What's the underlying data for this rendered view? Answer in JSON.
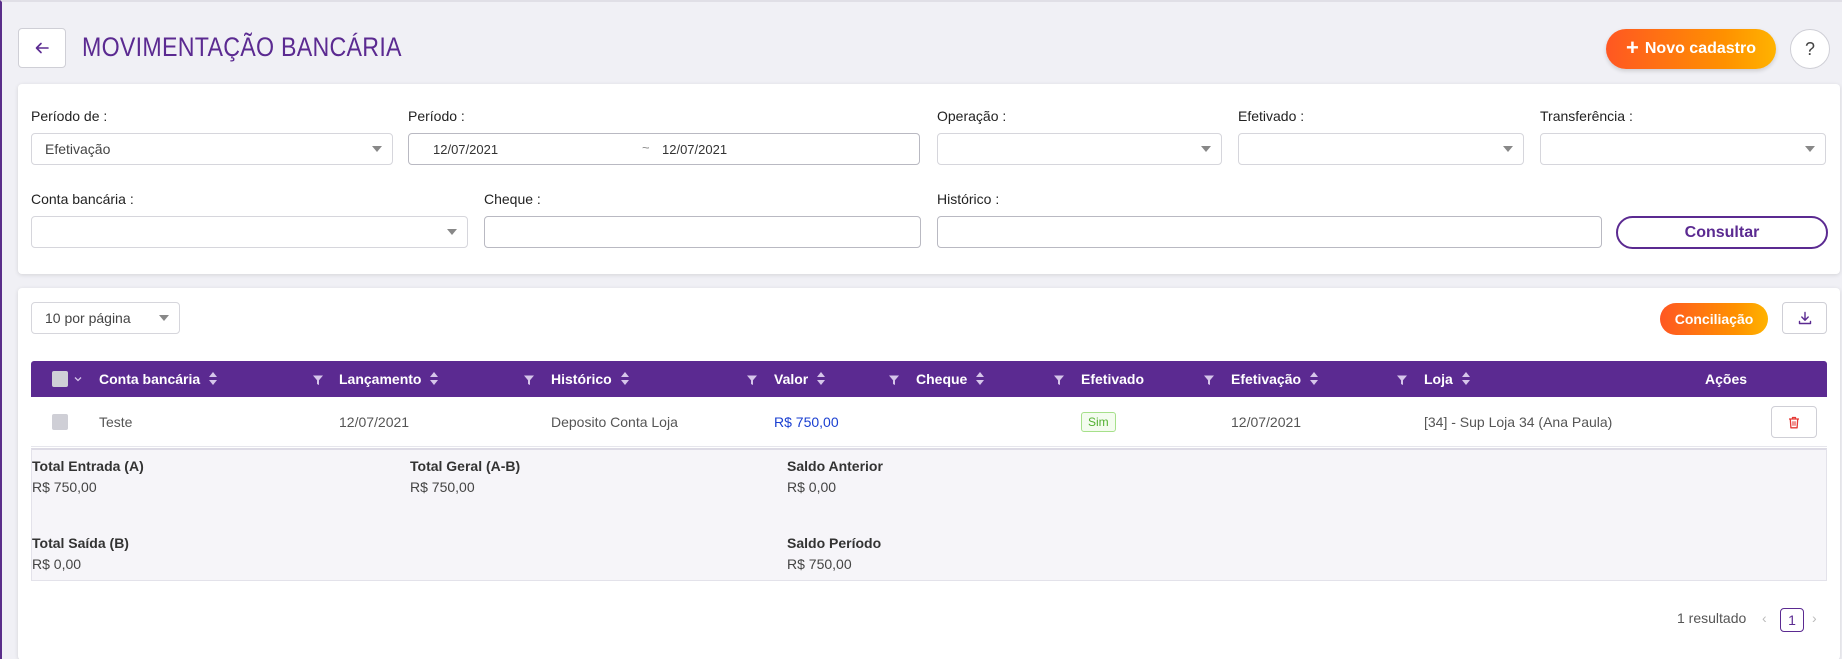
{
  "header": {
    "title": "MOVIMENTAÇÃO BANCÁRIA",
    "new_button": "Novo cadastro",
    "help_button": "?"
  },
  "filters": {
    "periodo_de": {
      "label": "Período de :",
      "value": "Efetivação"
    },
    "periodo": {
      "label": "Período :",
      "start": "12/07/2021",
      "separator": "~",
      "end": "12/07/2021"
    },
    "operacao": {
      "label": "Operação :",
      "value": ""
    },
    "efetivado": {
      "label": "Efetivado :",
      "value": ""
    },
    "transferencia": {
      "label": "Transferência :",
      "value": ""
    },
    "conta_bancaria": {
      "label": "Conta bancária :",
      "value": ""
    },
    "cheque": {
      "label": "Cheque :",
      "value": ""
    },
    "historico": {
      "label": "Histórico :",
      "value": ""
    },
    "consultar_button": "Consultar"
  },
  "results": {
    "per_page": "10 por página",
    "conciliacao_button": "Conciliação",
    "columns": [
      "Conta bancária",
      "Lançamento",
      "Histórico",
      "Valor",
      "Cheque",
      "Efetivado",
      "Efetivação",
      "Loja",
      "Ações"
    ],
    "rows": [
      {
        "conta_bancaria": "Teste",
        "lancamento": "12/07/2021",
        "historico": "Deposito Conta Loja",
        "valor": "R$ 750,00",
        "cheque": "",
        "efetivado": "Sim",
        "efetivacao": "12/07/2021",
        "loja": "[34] - Sup Loja 34 (Ana Paula)"
      }
    ],
    "totals": {
      "total_entrada": {
        "label": "Total Entrada (A)",
        "value": "R$ 750,00"
      },
      "total_geral": {
        "label": "Total Geral (A-B)",
        "value": "R$ 750,00"
      },
      "saldo_anterior": {
        "label": "Saldo Anterior",
        "value": "R$ 0,00"
      },
      "total_saida": {
        "label": "Total Saída (B)",
        "value": "R$ 0,00"
      },
      "saldo_periodo": {
        "label": "Saldo Período",
        "value": "R$ 750,00"
      }
    },
    "pagination": {
      "summary": "1 resultado",
      "current_page": "1",
      "prev": "‹",
      "next": "›"
    }
  },
  "colors": {
    "primary": "#5b2a91",
    "accent_start": "#ff5722",
    "accent_end": "#ffb300",
    "value_blue": "#1a3fd1",
    "delete_red": "#e53935"
  }
}
